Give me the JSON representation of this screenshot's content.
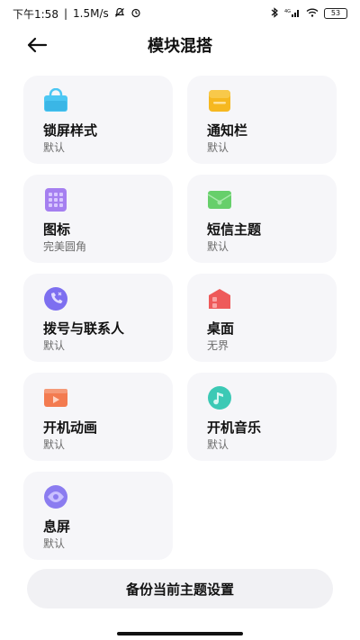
{
  "status_bar": {
    "time": "下午1:58",
    "speed": "1.5M/s",
    "battery": "53",
    "network": "4G"
  },
  "header": {
    "title": "模块混搭"
  },
  "cards": [
    {
      "name": "锁屏样式",
      "sub": "默认",
      "icon": "lock-screen-icon",
      "color": "#4cc7f3"
    },
    {
      "name": "通知栏",
      "sub": "默认",
      "icon": "notification-bar-icon",
      "color": "#f6b820"
    },
    {
      "name": "图标",
      "sub": "完美圆角",
      "icon": "app-icons-icon",
      "color": "#a57ff0"
    },
    {
      "name": "短信主题",
      "sub": "默认",
      "icon": "sms-theme-icon",
      "color": "#67cf6b"
    },
    {
      "name": "拨号与联系人",
      "sub": "默认",
      "icon": "dialer-contacts-icon",
      "color": "#7d6ff0"
    },
    {
      "name": "桌面",
      "sub": "无界",
      "icon": "desktop-icon",
      "color": "#ee5a5a"
    },
    {
      "name": "开机动画",
      "sub": "默认",
      "icon": "boot-animation-icon",
      "color": "#f37b50"
    },
    {
      "name": "开机音乐",
      "sub": "默认",
      "icon": "boot-music-icon",
      "color": "#3cc9b5"
    },
    {
      "name": "息屏",
      "sub": "默认",
      "icon": "screen-off-icon",
      "color": "#8b7cf0"
    }
  ],
  "backup_button": {
    "label": "备份当前主题设置"
  }
}
